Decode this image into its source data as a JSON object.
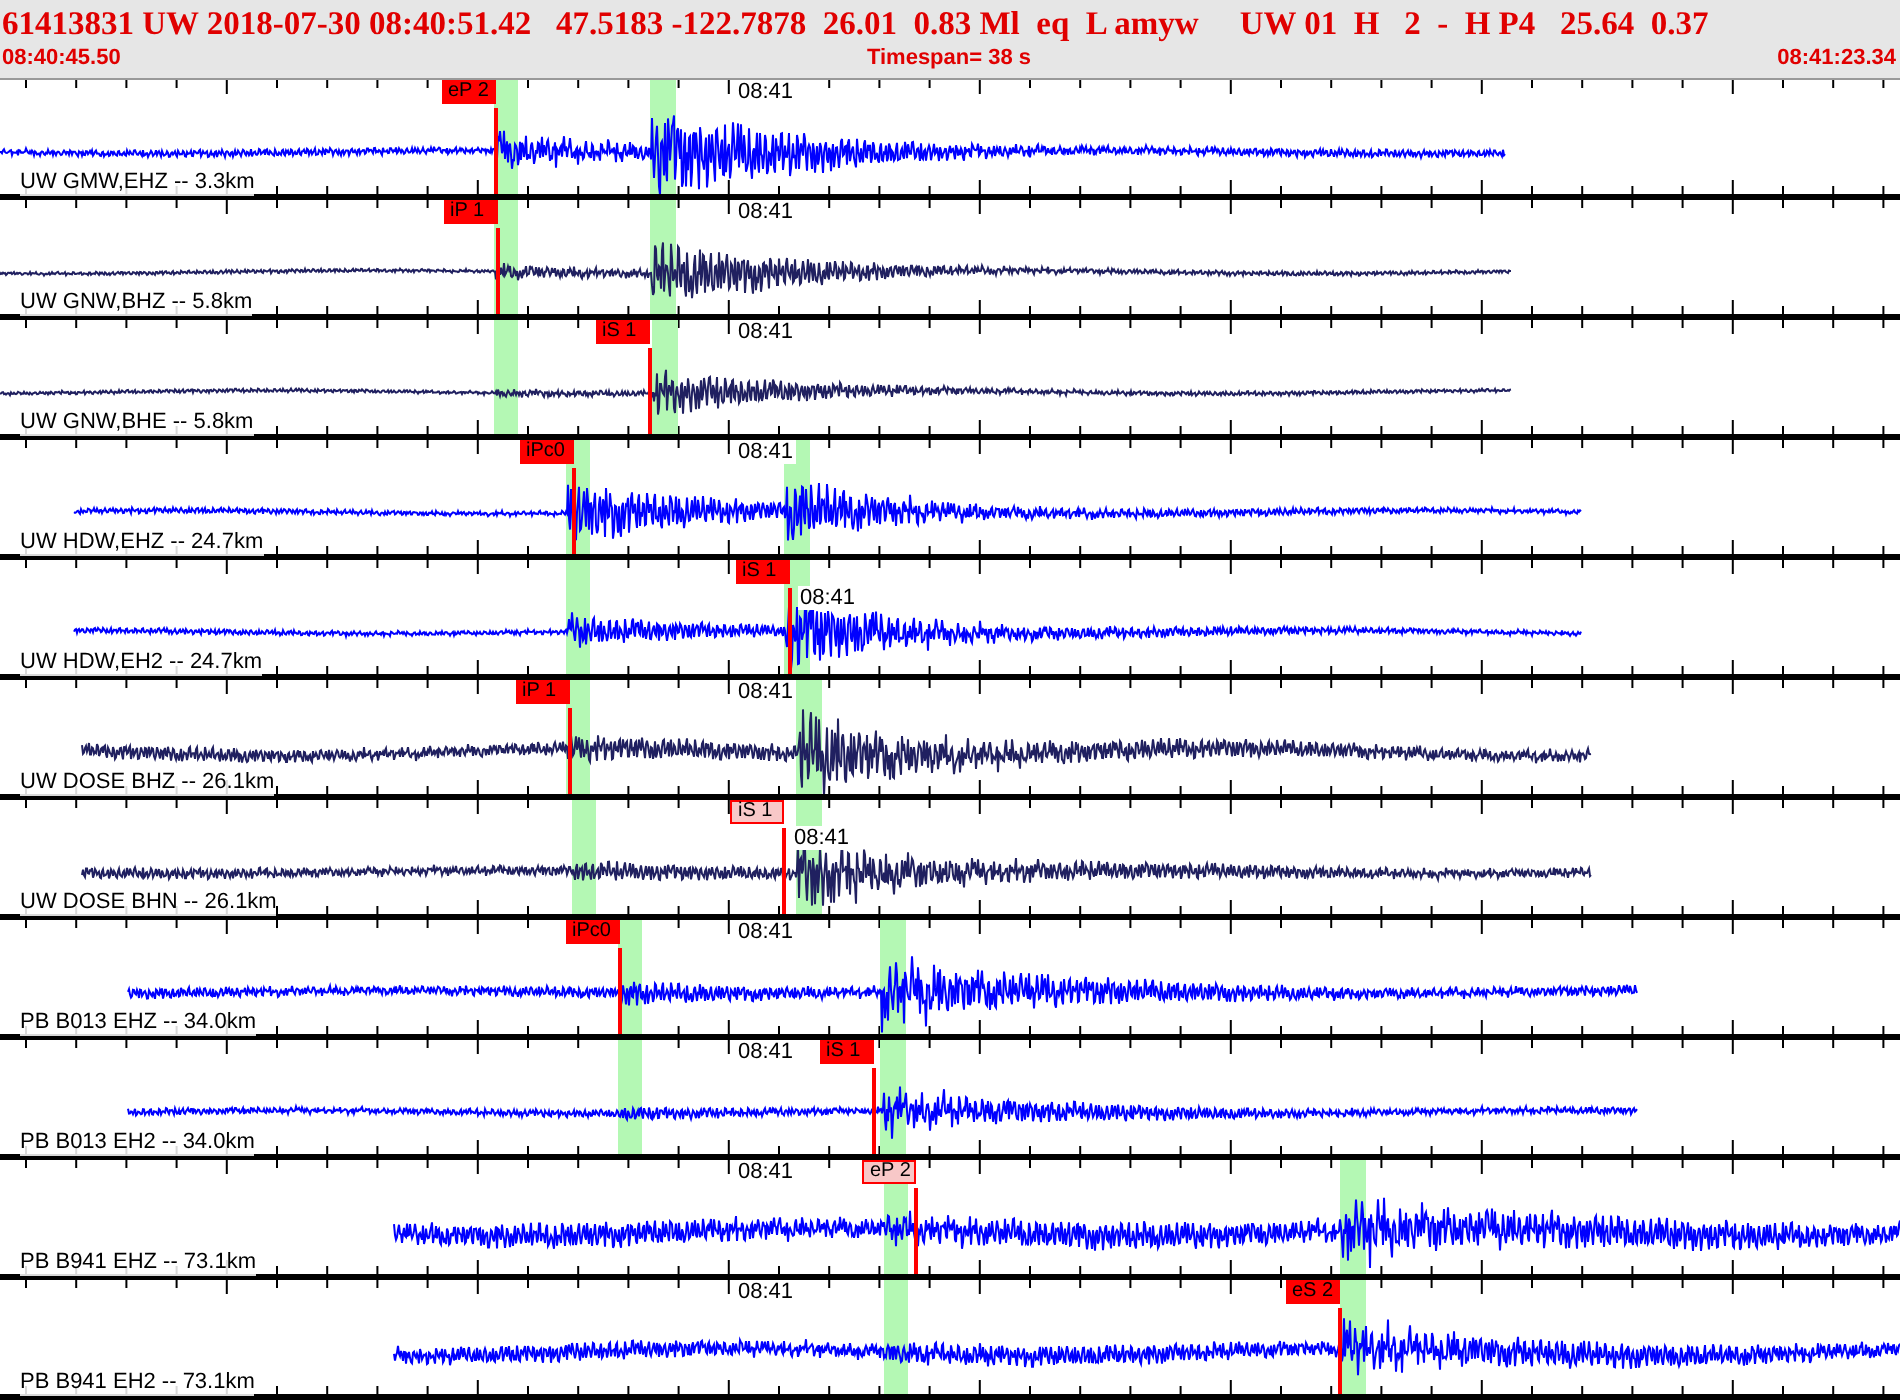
{
  "header": {
    "title": "61413831 UW 2018-07-30 08:40:51.42   47.5183 -122.7878  26.01  0.83 Ml  eq  L amyw     UW 01  H   2  -  H P4   25.64  0.37",
    "start_time": "08:40:45.50",
    "timespan": "Timespan=  38 s",
    "end_time": "08:41:23.34"
  },
  "traces": [
    {
      "label": "UW GMW,EHZ -- 3.3km",
      "time_mark": "08:41",
      "color": "#0000ff",
      "pick": {
        "label": "eP 2",
        "faded": false
      }
    },
    {
      "label": "UW GNW,BHZ -- 5.8km",
      "time_mark": "08:41",
      "color": "#202060",
      "pick": {
        "label": "iP 1",
        "faded": false
      }
    },
    {
      "label": "UW GNW,BHE -- 5.8km",
      "time_mark": "08:41",
      "color": "#202060",
      "pick": {
        "label": "iS 1",
        "faded": false
      }
    },
    {
      "label": "UW HDW,EHZ -- 24.7km",
      "time_mark": "08:41",
      "color": "#0000ff",
      "pick": {
        "label": "iPc0",
        "faded": false
      }
    },
    {
      "label": "UW HDW,EH2 -- 24.7km",
      "time_mark": "08:41",
      "color": "#0000ff",
      "pick": {
        "label": "iS 1",
        "faded": false
      }
    },
    {
      "label": "UW DOSE BHZ -- 26.1km",
      "time_mark": "08:41",
      "color": "#202060",
      "pick": {
        "label": "iP 1",
        "faded": false
      }
    },
    {
      "label": "UW DOSE BHN -- 26.1km",
      "time_mark": "08:41",
      "color": "#202060",
      "pick": {
        "label": "iS 1",
        "faded": true
      }
    },
    {
      "label": "PB B013 EHZ -- 34.0km",
      "time_mark": "08:41",
      "color": "#0000ff",
      "pick": {
        "label": "iPc0",
        "faded": false
      }
    },
    {
      "label": "PB B013 EH2 -- 34.0km",
      "time_mark": "08:41",
      "color": "#0000ff",
      "pick": {
        "label": "iS 1",
        "faded": false
      }
    },
    {
      "label": "PB B941 EHZ -- 73.1km",
      "time_mark": "08:41",
      "color": "#0000ff",
      "pick": {
        "label": "eP 2",
        "faded": true
      }
    },
    {
      "label": "PB B941 EH2 -- 73.1km",
      "time_mark": "08:41",
      "color": "#0000ff",
      "pick": {
        "label": "eS 2",
        "faded": false
      }
    }
  ]
}
